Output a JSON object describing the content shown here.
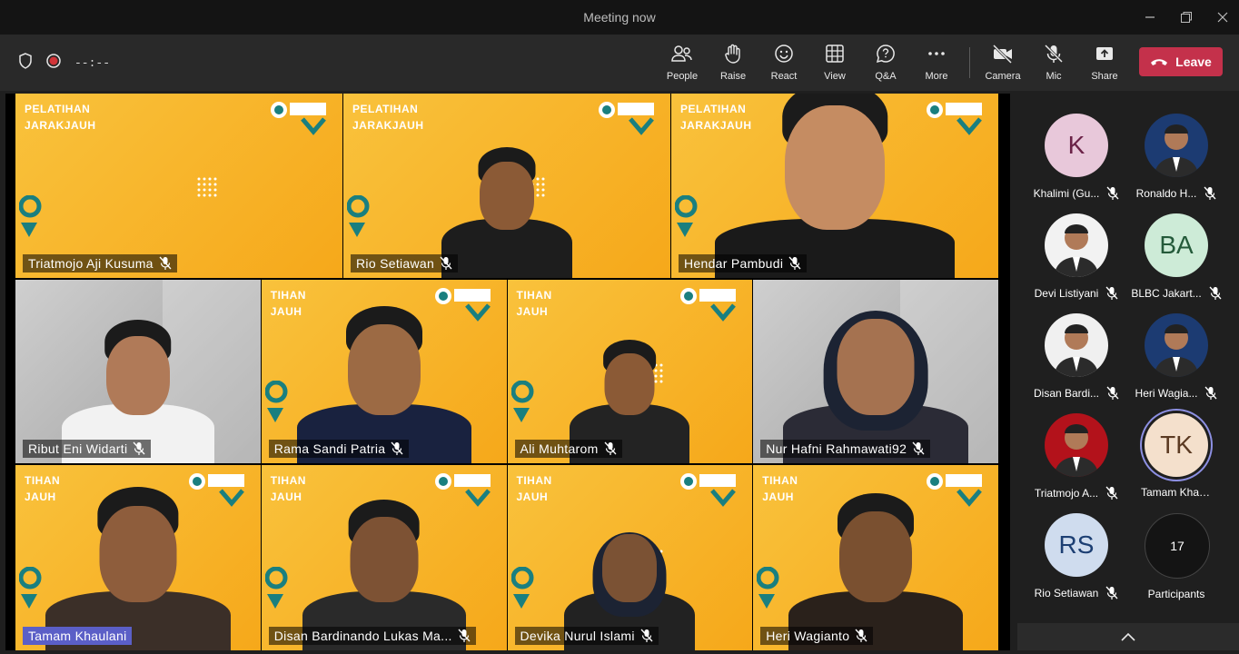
{
  "window": {
    "title": "Meeting now"
  },
  "toolbar": {
    "timer": "--:--",
    "buttons": [
      {
        "label": "People",
        "icon": "people-icon"
      },
      {
        "label": "Raise",
        "icon": "raise-hand-icon"
      },
      {
        "label": "React",
        "icon": "smiley-icon"
      },
      {
        "label": "View",
        "icon": "grid-view-icon"
      },
      {
        "label": "Q&A",
        "icon": "qa-icon"
      },
      {
        "label": "More",
        "icon": "more-icon"
      },
      {
        "label": "Camera",
        "icon": "camera-off-icon"
      },
      {
        "label": "Mic",
        "icon": "mic-off-icon"
      },
      {
        "label": "Share",
        "icon": "share-icon"
      }
    ],
    "leave_label": "Leave"
  },
  "branding": {
    "line1": "PELATIHAN",
    "line2": "JARAKJAUH",
    "line1_cropped": "TIHAN",
    "line2_cropped": "JAUH"
  },
  "video_tiles": [
    {
      "name": "Triatmojo Aji Kusuma",
      "muted": true
    },
    {
      "name": "Rio Setiawan",
      "muted": true
    },
    {
      "name": "Hendar Pambudi",
      "muted": true
    },
    {
      "name": "Ribut Eni Widarti",
      "muted": true
    },
    {
      "name": "Rama Sandi Patria",
      "muted": true
    },
    {
      "name": "Ali Muhtarom",
      "muted": true
    },
    {
      "name": "Nur Hafni Rahmawati92",
      "muted": true
    },
    {
      "name": "Tamam Khaulani",
      "muted": false,
      "active_speaker": true
    },
    {
      "name": "Disan Bardinando Lukas Ma...",
      "muted": true
    },
    {
      "name": "Devika Nurul Islami",
      "muted": true
    },
    {
      "name": "Heri Wagianto",
      "muted": true
    }
  ],
  "roster": [
    {
      "name": "Khalimi (Gu...",
      "initials": "K",
      "muted": true,
      "color": "#e8c8da",
      "text_color": "#6b2247"
    },
    {
      "name": "Ronaldo H...",
      "initials": "",
      "muted": true,
      "color": "#1c3b72"
    },
    {
      "name": "Devi Listiyani",
      "initials": "",
      "muted": true,
      "color": "#f2f2f2"
    },
    {
      "name": "BLBC Jakart...",
      "initials": "BA",
      "muted": true,
      "color": "#cdebd7",
      "text_color": "#245a3a"
    },
    {
      "name": "Disan Bardi...",
      "initials": "",
      "muted": true,
      "color": "#f0f0f0"
    },
    {
      "name": "Heri Wagia...",
      "initials": "",
      "muted": true,
      "color": "#1c3b72"
    },
    {
      "name": "Triatmojo A...",
      "initials": "",
      "muted": true,
      "color": "#b3121b"
    },
    {
      "name": "Tamam Khaulani",
      "initials": "TK",
      "muted": false,
      "color": "#f4e0cc",
      "text_color": "#5b3a22",
      "speaking": true
    },
    {
      "name": "Rio Setiawan",
      "initials": "RS",
      "muted": true,
      "color": "#cfdcee",
      "text_color": "#1d3f73"
    }
  ],
  "participants": {
    "count": "17",
    "label": "Participants"
  },
  "colors": {
    "leave": "#c4314b",
    "active_speaker": "#5b5fc7",
    "brand_yellow": "#f6b21a",
    "teal": "#1a7f7f"
  }
}
